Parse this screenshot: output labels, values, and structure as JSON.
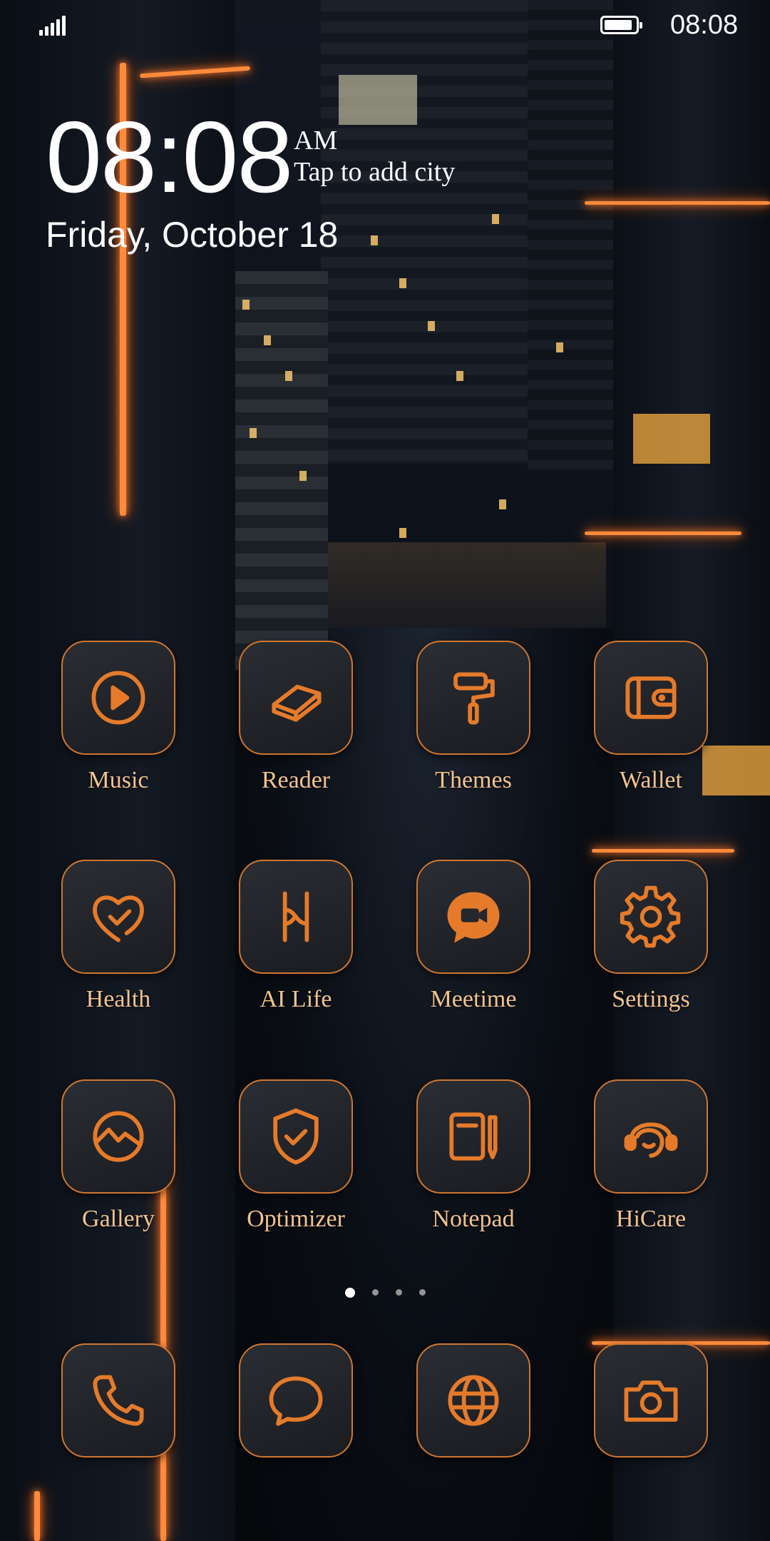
{
  "status_bar": {
    "time": "08:08",
    "battery_level": 0.9
  },
  "clock_widget": {
    "time": "08:08",
    "ampm": "AM",
    "city_prompt": "Tap to add city",
    "date": "Friday, October 18"
  },
  "colors": {
    "accent": "#d0762f",
    "label": "#f2c38e",
    "tile_bg": "#24272c"
  },
  "apps": [
    {
      "label": "Music",
      "icon": "play-circle-icon"
    },
    {
      "label": "Reader",
      "icon": "book-icon"
    },
    {
      "label": "Themes",
      "icon": "paint-roller-icon"
    },
    {
      "label": "Wallet",
      "icon": "wallet-icon"
    },
    {
      "label": "Health",
      "icon": "heart-check-icon"
    },
    {
      "label": "AI Life",
      "icon": "ai-life-icon"
    },
    {
      "label": "Meetime",
      "icon": "video-chat-icon"
    },
    {
      "label": "Settings",
      "icon": "gear-icon"
    },
    {
      "label": "Gallery",
      "icon": "gallery-icon"
    },
    {
      "label": "Optimizer",
      "icon": "shield-check-icon"
    },
    {
      "label": "Notepad",
      "icon": "notepad-icon"
    },
    {
      "label": "HiCare",
      "icon": "headset-icon"
    }
  ],
  "page_indicator": {
    "pages": 4,
    "current": 1
  },
  "dock": [
    {
      "icon": "phone-icon"
    },
    {
      "icon": "message-icon"
    },
    {
      "icon": "browser-icon"
    },
    {
      "icon": "camera-icon"
    }
  ]
}
